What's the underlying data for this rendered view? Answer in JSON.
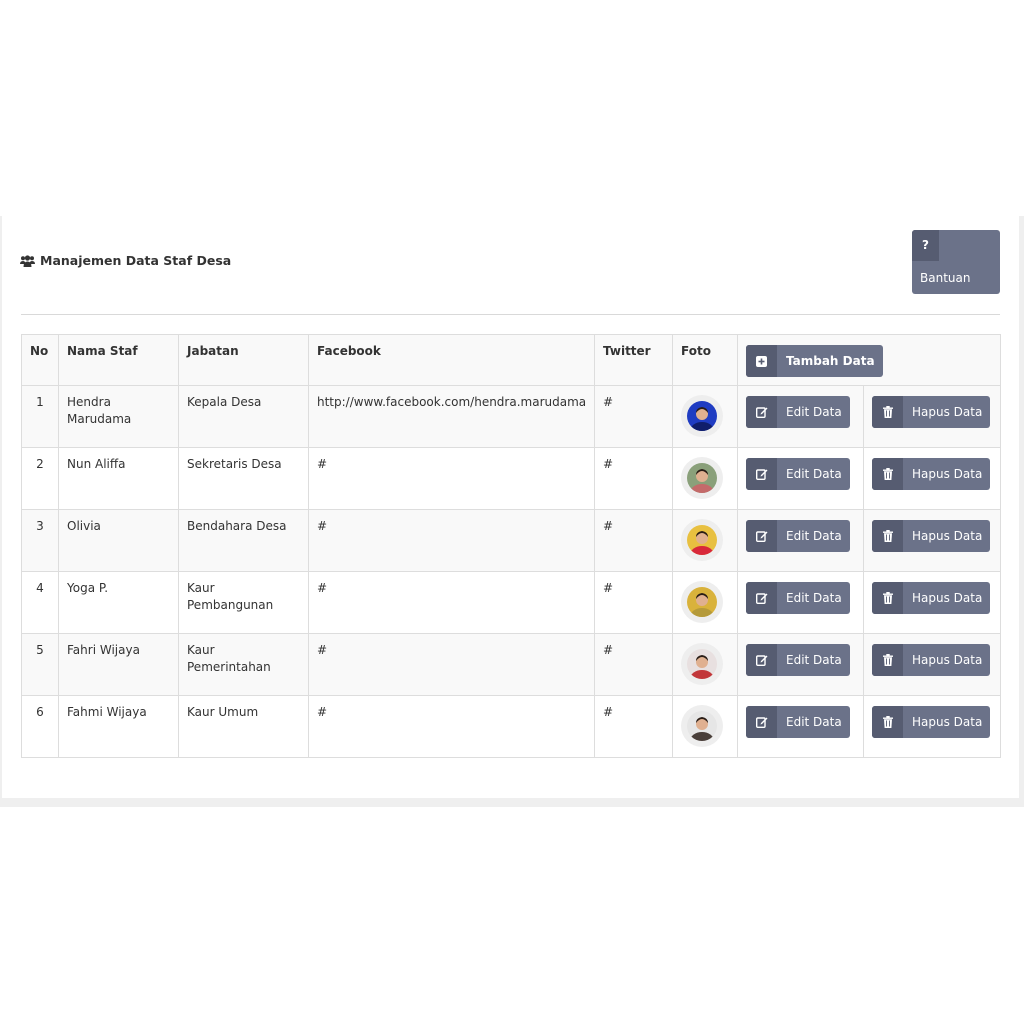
{
  "header": {
    "title": "Manajemen Data Staf Desa",
    "help_button": {
      "icon": "?",
      "label": "Bantuan"
    }
  },
  "table": {
    "columns": [
      "No",
      "Nama Staf",
      "Jabatan",
      "Facebook",
      "Twitter",
      "Foto"
    ],
    "add_button_label": "Tambah Data",
    "edit_label": "Edit Data",
    "delete_label": "Hapus Data",
    "rows": [
      {
        "no": "1",
        "name": "Hendra Marudama",
        "position": "Kepala Desa",
        "facebook": "http://www.facebook.com/hendra.marudama",
        "twitter": "#"
      },
      {
        "no": "2",
        "name": "Nun Aliffa",
        "position": "Sekretaris Desa",
        "facebook": "#",
        "twitter": "#"
      },
      {
        "no": "3",
        "name": "Olivia",
        "position": "Bendahara Desa",
        "facebook": "#",
        "twitter": "#"
      },
      {
        "no": "4",
        "name": "Yoga P.",
        "position": "Kaur Pembangunan",
        "facebook": "#",
        "twitter": "#"
      },
      {
        "no": "5",
        "name": "Fahri Wijaya",
        "position": "Kaur Pemerintahan",
        "facebook": "#",
        "twitter": "#"
      },
      {
        "no": "6",
        "name": "Fahmi Wijaya",
        "position": "Kaur Umum",
        "facebook": "#",
        "twitter": "#"
      }
    ]
  },
  "colors": {
    "button": "#6b7289",
    "button_icon_bg": "#565c71",
    "border": "#dddddd",
    "stripe": "#f9f9f9"
  }
}
